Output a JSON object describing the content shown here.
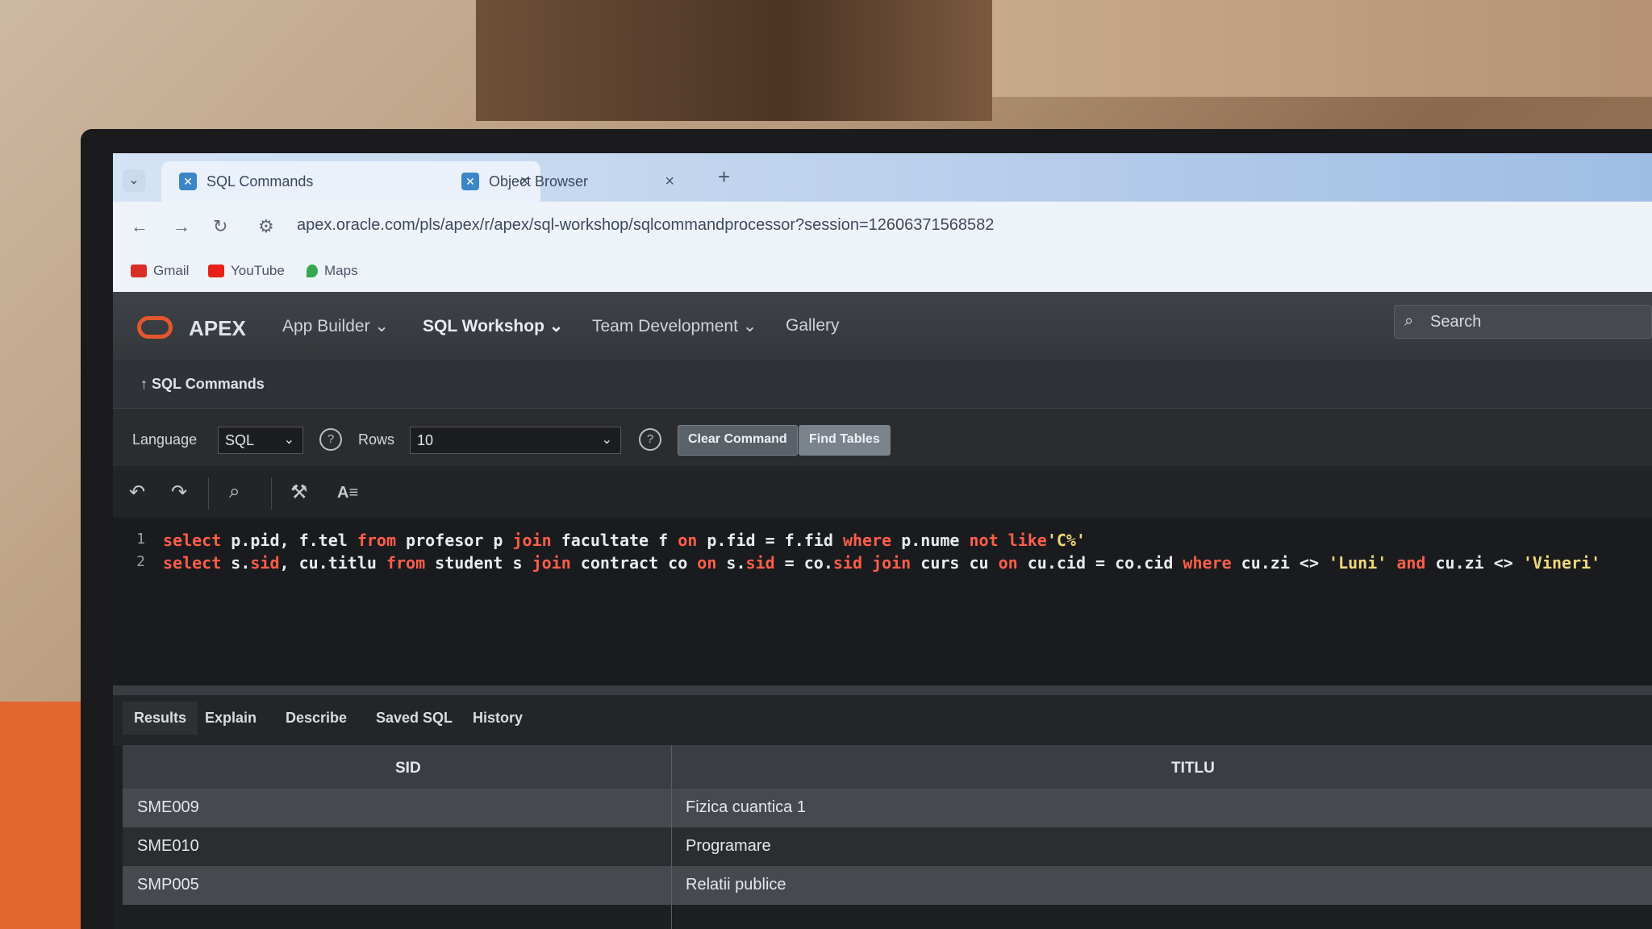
{
  "browser": {
    "tabs": [
      {
        "title": "SQL Commands",
        "active": true
      },
      {
        "title": "Object Browser",
        "active": false
      }
    ],
    "url": "apex.oracle.com/pls/apex/r/apex/sql-workshop/sqlcommandprocessor?session=12606371568582",
    "bookmarks": [
      "Gmail",
      "YouTube",
      "Maps"
    ]
  },
  "apex": {
    "logo": "APEX",
    "menu": [
      "App Builder",
      "SQL Workshop",
      "Team Development",
      "Gallery"
    ],
    "search_placeholder": "Search",
    "breadcrumb": "SQL Commands"
  },
  "toolbar": {
    "language_label": "Language",
    "language_value": "SQL",
    "rows_label": "Rows",
    "rows_value": "10",
    "clear_command": "Clear Command",
    "find_tables": "Find Tables",
    "format_label": "A≡"
  },
  "editor": {
    "lines": [
      {
        "num": "1",
        "tokens": [
          {
            "t": "select",
            "k": "kw"
          },
          {
            "t": " p.pid, f.tel "
          },
          {
            "t": "from",
            "k": "kw"
          },
          {
            "t": " profesor p "
          },
          {
            "t": "join",
            "k": "kw"
          },
          {
            "t": " facultate f "
          },
          {
            "t": "on",
            "k": "kw"
          },
          {
            "t": " p.fid = f.fid "
          },
          {
            "t": "where",
            "k": "kw"
          },
          {
            "t": " p.nume "
          },
          {
            "t": "not like",
            "k": "kw"
          },
          {
            "t": "'C%'",
            "k": "str"
          }
        ]
      },
      {
        "num": "2",
        "tokens": [
          {
            "t": "select",
            "k": "kw"
          },
          {
            "t": " s."
          },
          {
            "t": "sid",
            "k": "kw"
          },
          {
            "t": ", cu.titlu "
          },
          {
            "t": "from",
            "k": "kw"
          },
          {
            "t": " student s "
          },
          {
            "t": "join",
            "k": "kw"
          },
          {
            "t": " contract co "
          },
          {
            "t": "on",
            "k": "kw"
          },
          {
            "t": " s."
          },
          {
            "t": "sid",
            "k": "kw"
          },
          {
            "t": " = co."
          },
          {
            "t": "sid",
            "k": "kw"
          },
          {
            "t": " "
          },
          {
            "t": "join",
            "k": "kw"
          },
          {
            "t": " curs cu "
          },
          {
            "t": "on",
            "k": "kw"
          },
          {
            "t": " cu.cid = co.cid "
          },
          {
            "t": "where",
            "k": "kw"
          },
          {
            "t": " cu.zi <> "
          },
          {
            "t": "'Luni'",
            "k": "str"
          },
          {
            "t": " "
          },
          {
            "t": "and",
            "k": "kw"
          },
          {
            "t": " cu.zi <> "
          },
          {
            "t": "'Vineri'",
            "k": "str"
          }
        ]
      }
    ]
  },
  "results": {
    "tabs": [
      "Results",
      "Explain",
      "Describe",
      "Saved SQL",
      "History"
    ],
    "columns": [
      "SID",
      "TITLU"
    ],
    "rows": [
      [
        "SME009",
        "Fizica cuantica 1"
      ],
      [
        "SME010",
        "Programare"
      ],
      [
        "SMP005",
        "Relatii publice"
      ]
    ]
  },
  "colors": {
    "keyword": "#ff5e49",
    "string": "#f0d878",
    "apex_logo": "#e4572e"
  }
}
